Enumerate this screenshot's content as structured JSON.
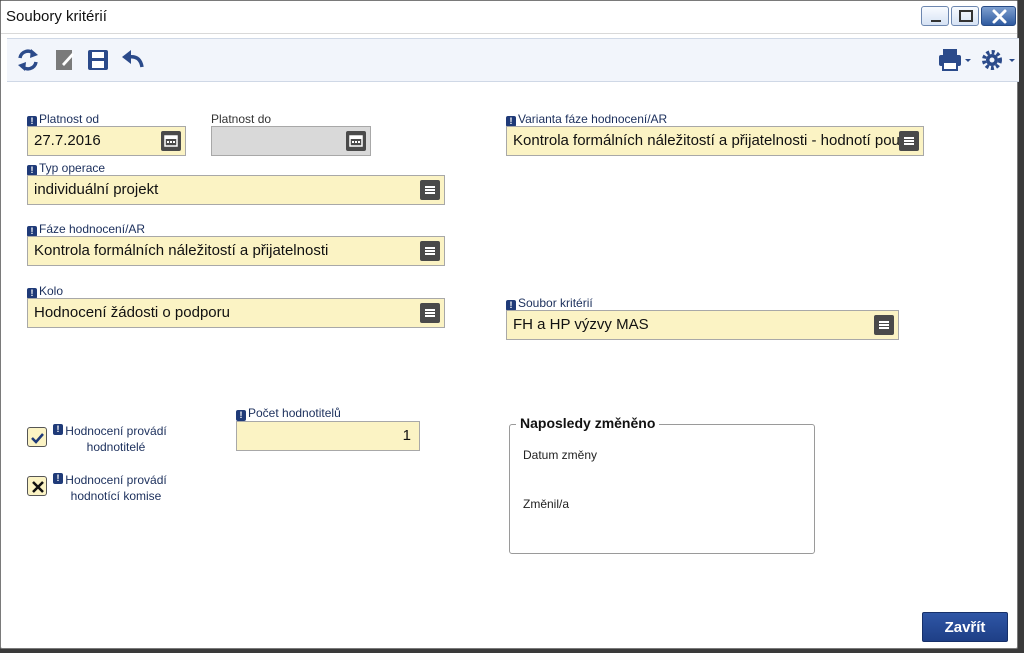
{
  "window": {
    "title": "Soubory kritérií"
  },
  "form": {
    "platnost_od": {
      "label": "Platnost od",
      "value": "27.7.2016"
    },
    "platnost_do": {
      "label": "Platnost do",
      "value": ""
    },
    "varianta": {
      "label": "Varianta fáze hodnocení/AR",
      "value": "Kontrola formálních náležitostí a přijatelnosti - hodnotí pouze"
    },
    "typ_operace": {
      "label": "Typ operace",
      "value": "individuální projekt"
    },
    "faze": {
      "label": "Fáze hodnocení/AR",
      "value": "Kontrola formálních náležitostí a přijatelnosti"
    },
    "kolo": {
      "label": "Kolo",
      "value": "Hodnocení žádosti o podporu"
    },
    "soubor_kriterii": {
      "label": "Soubor kritérií",
      "value": "FH a HP výzvy MAS"
    },
    "hodnotitele": {
      "label_line1": "Hodnocení provádí",
      "label_line2": "hodnotitelé",
      "checked": true
    },
    "komise": {
      "label_line1": "Hodnocení provádí",
      "label_line2": "hodnotící komise",
      "checked": false
    },
    "pocet": {
      "label": "Počet hodnotitelů",
      "value": "1"
    }
  },
  "last_changed": {
    "legend": "Naposledy změněno",
    "datum_label": "Datum změny",
    "zmenil_label": "Změnil/a"
  },
  "buttons": {
    "close": "Zavřít"
  },
  "colors": {
    "required_field": "#fbf3c4",
    "accent": "#1f3a78"
  }
}
